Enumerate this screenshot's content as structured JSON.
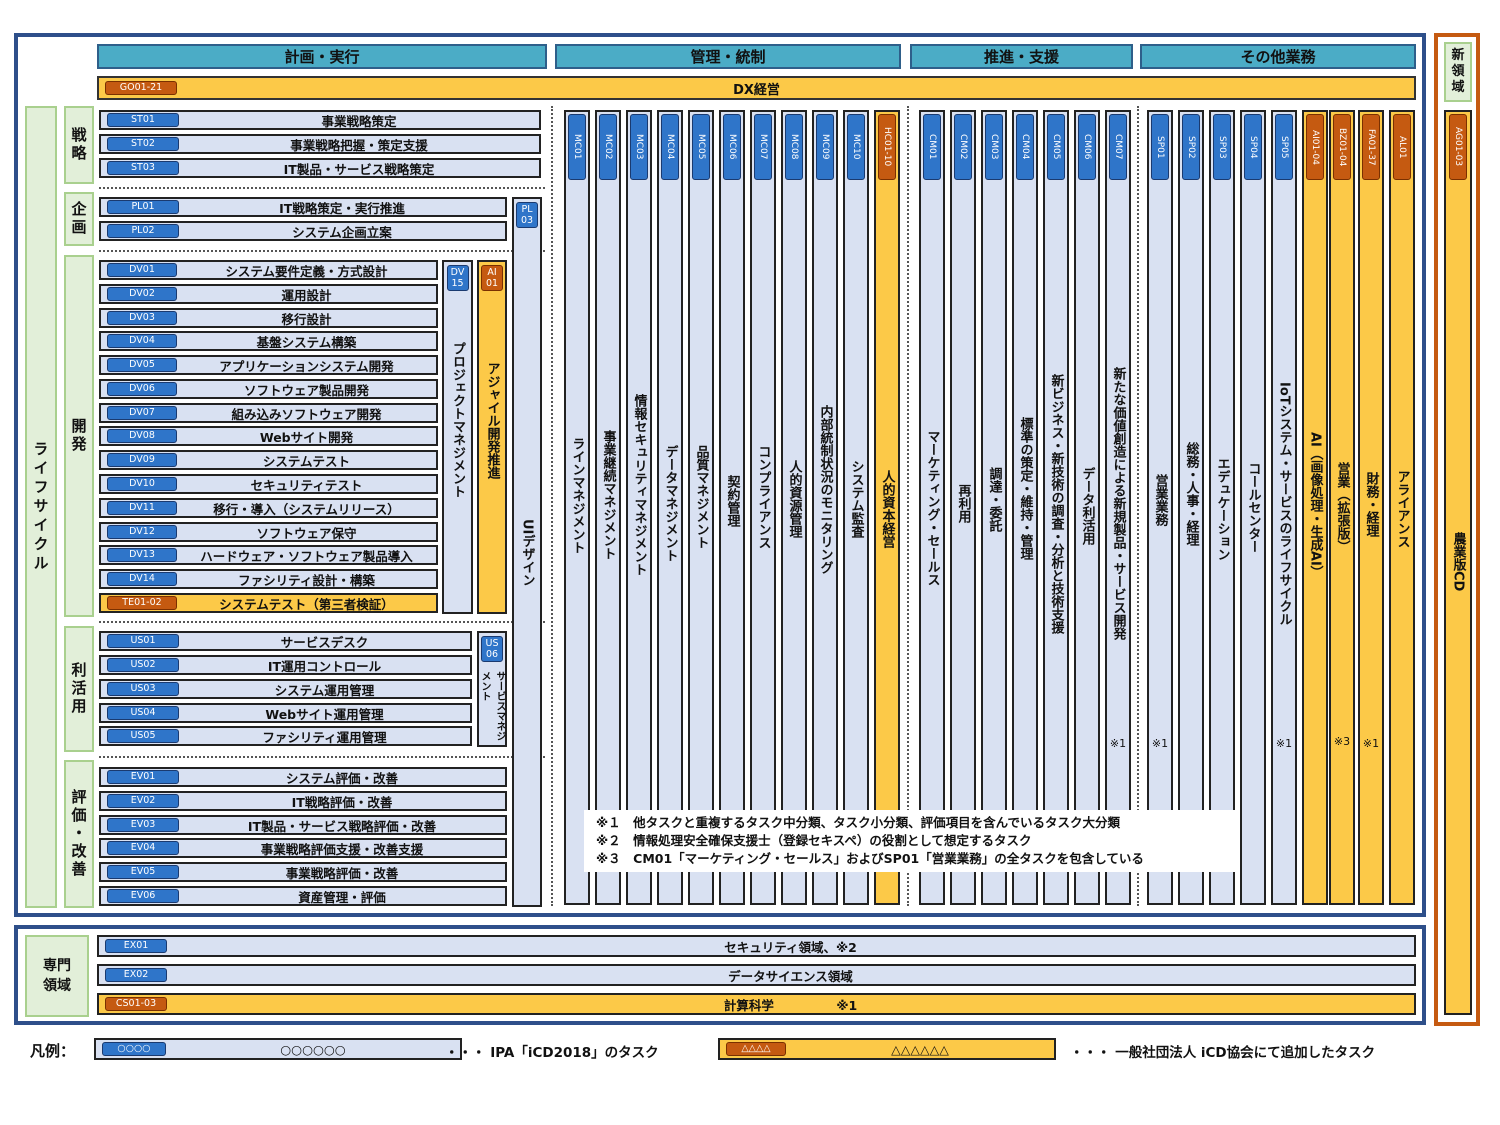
{
  "headers": {
    "plan": "計画・実行",
    "manage": "管理・統制",
    "promote": "推進・支援",
    "other": "その他業務",
    "new": "新領域"
  },
  "dx": {
    "code": "GO01-21",
    "label": "DX経営"
  },
  "lifecycle": "ライフサイクル",
  "categories": {
    "strategy": "戦略",
    "planning": "企画",
    "dev": "開発",
    "use": "利活用",
    "eval": "評価・改善",
    "special": "専門領域"
  },
  "strategy": [
    {
      "code": "ST01",
      "label": "事業戦略策定"
    },
    {
      "code": "ST02",
      "label": "事業戦略把握・策定支援"
    },
    {
      "code": "ST03",
      "label": "IT製品・サービス戦略策定"
    }
  ],
  "planning": [
    {
      "code": "PL01",
      "label": "IT戦略策定・実行推進"
    },
    {
      "code": "PL02",
      "label": "システム企画立案"
    }
  ],
  "dev": [
    {
      "code": "DV01",
      "label": "システム要件定義・方式設計"
    },
    {
      "code": "DV02",
      "label": "運用設計"
    },
    {
      "code": "DV03",
      "label": "移行設計"
    },
    {
      "code": "DV04",
      "label": "基盤システム構築"
    },
    {
      "code": "DV05",
      "label": "アプリケーションシステム開発"
    },
    {
      "code": "DV06",
      "label": "ソフトウェア製品開発"
    },
    {
      "code": "DV07",
      "label": "組み込みソフトウェア開発"
    },
    {
      "code": "DV08",
      "label": "Webサイト開発"
    },
    {
      "code": "DV09",
      "label": "システムテスト"
    },
    {
      "code": "DV10",
      "label": "セキュリティテスト"
    },
    {
      "code": "DV11",
      "label": "移行・導入（システムリリース）"
    },
    {
      "code": "DV12",
      "label": "ソフトウェア保守"
    },
    {
      "code": "DV13",
      "label": "ハードウェア・ソフトウェア製品導入"
    },
    {
      "code": "DV14",
      "label": "ファシリティ設計・構築"
    },
    {
      "code": "TE01-02",
      "label": "システムテスト（第三者検証）"
    }
  ],
  "dv15": {
    "code": "DV 15",
    "label": "プロジェクトマネジメント"
  },
  "ai01": {
    "code": "AI 01",
    "label": "アジャイル開発推進"
  },
  "pl03": {
    "code": "PL 03",
    "label": "UIデザイン"
  },
  "use": [
    {
      "code": "US01",
      "label": "サービスデスク"
    },
    {
      "code": "US02",
      "label": "IT運用コントロール"
    },
    {
      "code": "US03",
      "label": "システム運用管理"
    },
    {
      "code": "US04",
      "label": "Webサイト運用管理"
    },
    {
      "code": "US05",
      "label": "ファシリティ運用管理"
    }
  ],
  "us06": {
    "code": "US 06",
    "label": "サービスマネジメント"
  },
  "eval": [
    {
      "code": "EV01",
      "label": "システム評価・改善"
    },
    {
      "code": "EV02",
      "label": "IT戦略評価・改善"
    },
    {
      "code": "EV03",
      "label": "IT製品・サービス戦略評価・改善"
    },
    {
      "code": "EV04",
      "label": "事業戦略評価支援・改善支援"
    },
    {
      "code": "EV05",
      "label": "事業戦略評価・改善"
    },
    {
      "code": "EV06",
      "label": "資産管理・評価"
    }
  ],
  "manage_cols": [
    {
      "code": "MC01",
      "label": "ラインマネジメント"
    },
    {
      "code": "MC02",
      "label": "事業継続マネジメント"
    },
    {
      "code": "MC03",
      "label": "情報セキュリティマネジメント"
    },
    {
      "code": "MC04",
      "label": "データマネジメント"
    },
    {
      "code": "MC05",
      "label": "品質マネジメント"
    },
    {
      "code": "MC06",
      "label": "契約管理"
    },
    {
      "code": "MC07",
      "label": "コンプライアンス"
    },
    {
      "code": "MC08",
      "label": "人的資源管理"
    },
    {
      "code": "MC09",
      "label": "内部統制状況のモニタリング"
    },
    {
      "code": "MC10",
      "label": "システム監査"
    },
    {
      "code": "HC01-10",
      "label": "人的資本経営",
      "y": true
    }
  ],
  "promote_cols": [
    {
      "code": "CM01",
      "label": "マーケティング・セールス"
    },
    {
      "code": "CM02",
      "label": "再利用"
    },
    {
      "code": "CM03",
      "label": "調達・委託"
    },
    {
      "code": "CM04",
      "label": "標準の策定・維持・管理"
    },
    {
      "code": "CM05",
      "label": "新ビジネス・新技術の調査・分析と技術支援"
    },
    {
      "code": "CM06",
      "label": "データ利活用"
    },
    {
      "code": "CM07",
      "label": "新たな価値創造による新規製品・サービス開発",
      "note": "※1"
    }
  ],
  "other_cols": [
    {
      "code": "SP01",
      "label": "営業業務",
      "note": "※1"
    },
    {
      "code": "SP02",
      "label": "総務・人事・経理"
    },
    {
      "code": "SP03",
      "label": "エデュケーション"
    },
    {
      "code": "SP04",
      "label": "コールセンター"
    },
    {
      "code": "SP05",
      "label": "IoTシステム・サービスのライフサイクル",
      "note": "※1"
    },
    {
      "code": "AI01-04",
      "label": "AI（画像処理・生成AI）",
      "y": true
    },
    {
      "code": "BZ01-04",
      "label": "営業（拡張版）",
      "y": true,
      "note": "※3"
    },
    {
      "code": "FA01-37",
      "label": "財務・経理",
      "y": true,
      "note": "※1"
    },
    {
      "code": "AL01",
      "label": "アライアンス",
      "y": true
    }
  ],
  "agri": {
    "code": "AG01-03",
    "label": "農業版CD"
  },
  "notes": [
    "※１　他タスクと重複するタスク中分類、タスク小分類、評価項目を含んでいるタスク大分類",
    "※２　情報処理安全確保支援士（登録セキスペ）の役割として想定するタスク",
    "※３　CM01「マーケティング・セールス」およびSP01「営業業務」の全タスクを包含している"
  ],
  "special": [
    {
      "code": "EX01",
      "label": "セキュリティ領域、※2"
    },
    {
      "code": "EX02",
      "label": "データサイエンス領域"
    },
    {
      "code": "CS01-03",
      "label": "計算科学　　　　　※1",
      "y": true
    }
  ],
  "legend": {
    "title": "凡例：",
    "ipa_code": "○○○○",
    "ipa_label": "○○○○○○",
    "ipa_desc": "・・・ IPA「iCD2018」のタスク",
    "icd_code": "△△△△",
    "icd_label": "△△△△△△",
    "icd_desc": "・・・ 一般社団法人 iCD協会にて追加したタスク"
  },
  "colors": {
    "blue_frame": "#2e4f8a",
    "orange_frame": "#c55a11",
    "header": "#4bacc6",
    "task": "#d9e1f2",
    "added": "#fcc948",
    "category": "#e2efd9"
  }
}
